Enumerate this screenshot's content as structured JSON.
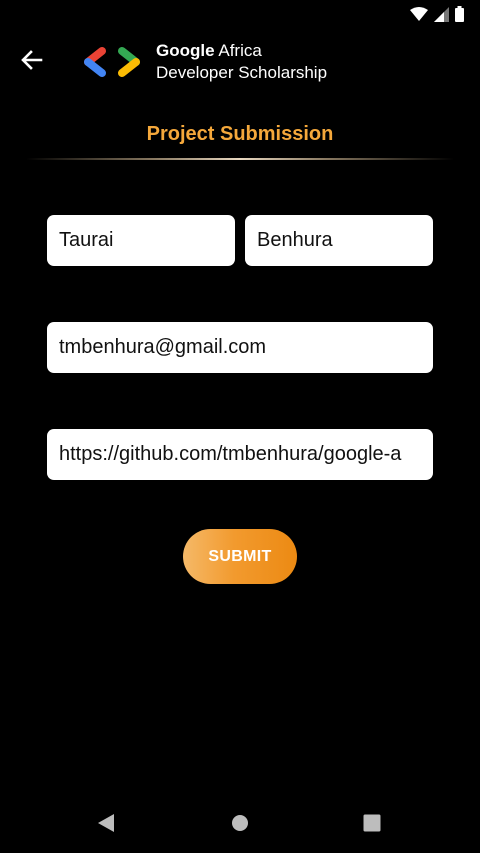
{
  "status_bar": {
    "icons": [
      "wifi-icon",
      "cellular-signal-icon",
      "battery-icon"
    ]
  },
  "header": {
    "back_icon": "arrow-left-icon",
    "logo_icon": "google-developers-logo-icon",
    "brand_google": "Google",
    "brand_africa": "Africa",
    "brand_line2": "Developer Scholarship"
  },
  "page": {
    "title": "Project Submission"
  },
  "form": {
    "first_name": "Taurai",
    "last_name": "Benhura",
    "email": "tmbenhura@gmail.com",
    "github_link": "https://github.com/tmbenhura/google-a",
    "submit_label": "SUBMIT"
  },
  "navigation": {
    "icons": [
      "back-triangle-icon",
      "home-circle-icon",
      "recents-square-icon"
    ]
  },
  "colors": {
    "background": "#000000",
    "title_accent": "#f5a83b",
    "button_gradient_start": "#f5b968",
    "button_gradient_end": "#ec8a13",
    "field_background": "#ffffff"
  }
}
